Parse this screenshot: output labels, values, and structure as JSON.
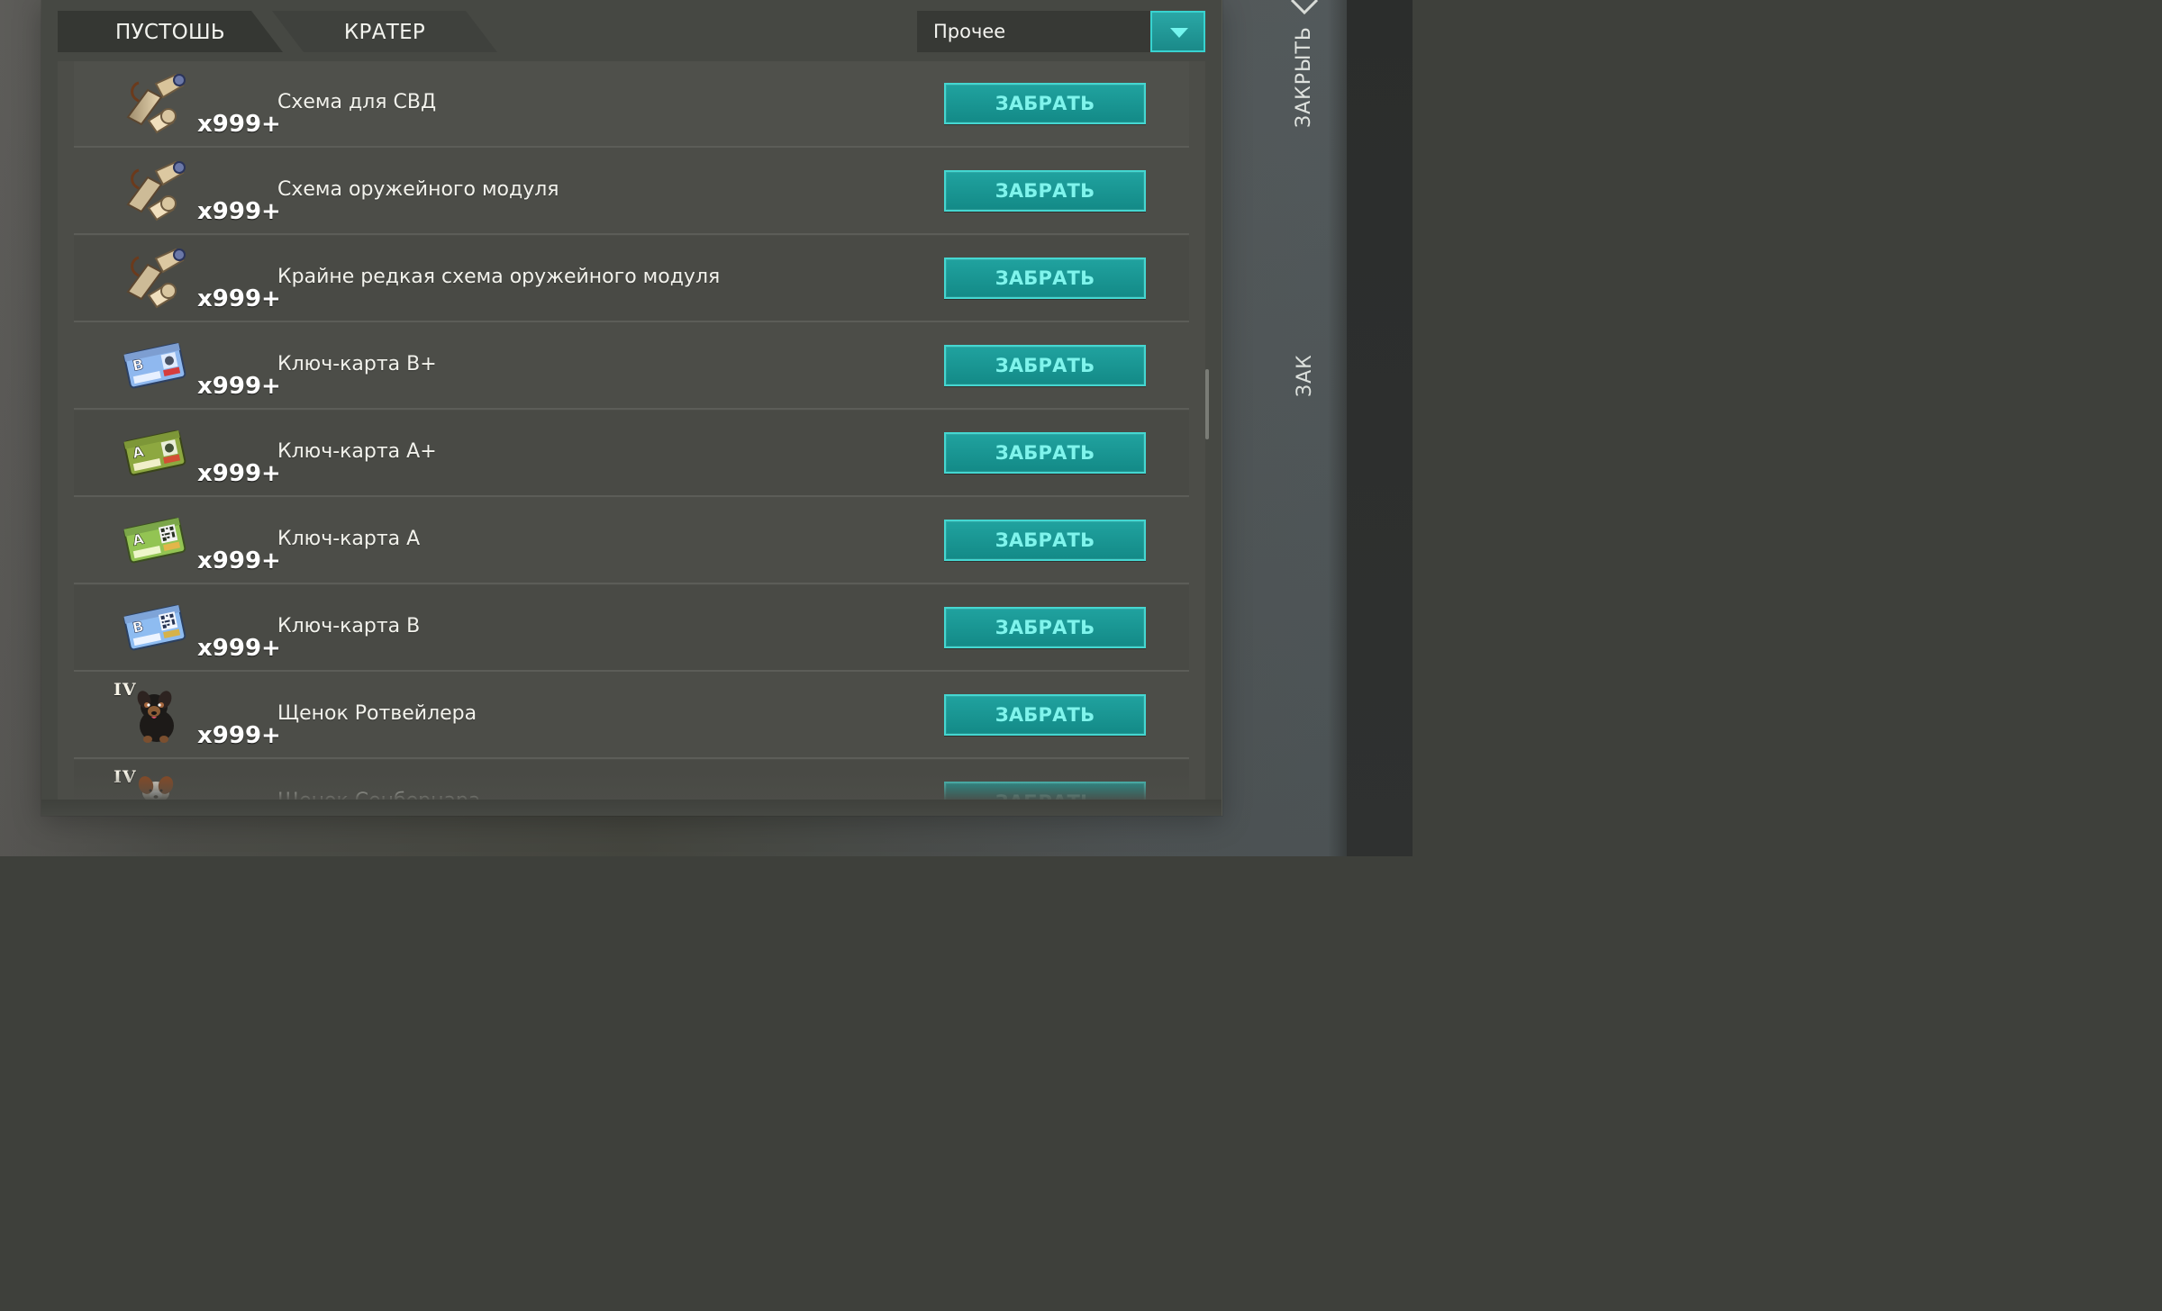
{
  "tabs": [
    {
      "label": "ПУСТОШЬ"
    },
    {
      "label": "КРАТЕР"
    }
  ],
  "filter": {
    "selected": "Прочее"
  },
  "close": {
    "label": "ЗАКРЫТЬ",
    "label_2": "ЗАК"
  },
  "items": [
    {
      "name": "Схема для СВД",
      "quantity": "x999+",
      "button": "ЗАБРАТЬ"
    },
    {
      "name": "Схема оружейного модуля",
      "quantity": "x999+",
      "button": "ЗАБРАТЬ"
    },
    {
      "name": "Крайне редкая схема оружейного модуля",
      "quantity": "x999+",
      "button": "ЗАБРАТЬ"
    },
    {
      "name": "Ключ-карта В+",
      "quantity": "x999+",
      "button": "ЗАБРАТЬ"
    },
    {
      "name": "Ключ-карта А+",
      "quantity": "x999+",
      "button": "ЗАБРАТЬ"
    },
    {
      "name": "Ключ-карта А",
      "quantity": "x999+",
      "button": "ЗАБРАТЬ"
    },
    {
      "name": "Ключ-карта В",
      "quantity": "x999+",
      "button": "ЗАБРАТЬ"
    },
    {
      "name": "Щенок Ротвейлера",
      "quantity": "x999+",
      "button": "ЗАБРАТЬ",
      "tier": "IV"
    },
    {
      "name": "Щенок Сенбернара",
      "quantity": "",
      "button": "ЗАБРАТЬ",
      "tier": "IV"
    }
  ],
  "icons": {
    "scroll": "scroll-icon",
    "keycard_b": "keycard-b-icon",
    "keycard_a": "keycard-a-icon",
    "dog_rottweiler": "rottweiler-puppy-icon",
    "dog_saint_bernard": "saint-bernard-puppy-icon",
    "close": "close-icon",
    "dropdown": "chevron-down-icon"
  },
  "colors": {
    "accent": "#1b9491",
    "accent_border": "#44d7d1",
    "text": "#f2f2ec"
  }
}
